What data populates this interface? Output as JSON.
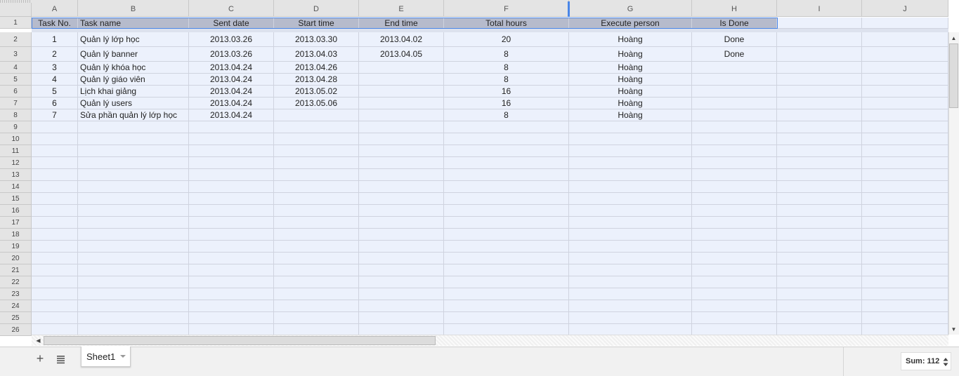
{
  "columns": [
    "A",
    "B",
    "C",
    "D",
    "E",
    "F",
    "G",
    "H",
    "I",
    "J"
  ],
  "header_row": [
    "Task No.",
    "Task name",
    "Sent date",
    "Start time",
    "End time",
    "Total hours",
    "Execute person",
    "Is Done",
    "",
    ""
  ],
  "rows": [
    [
      "1",
      "Quản lý lớp học",
      "2013.03.26",
      "2013.03.30",
      "2013.04.02",
      "20",
      "Hoàng",
      "Done",
      "",
      ""
    ],
    [
      "2",
      "Quản lý banner",
      "2013.03.26",
      "2013.04.03",
      "2013.04.05",
      "8",
      "Hoàng",
      "Done",
      "",
      ""
    ],
    [
      "3",
      "Quản lý khóa học",
      "2013.04.24",
      "2013.04.26",
      "",
      "8",
      "Hoàng",
      "",
      "",
      ""
    ],
    [
      "4",
      "Quản lý giáo viên",
      "2013.04.24",
      "2013.04.28",
      "",
      "8",
      "Hoàng",
      "",
      "",
      ""
    ],
    [
      "5",
      "Lịch khai giảng",
      "2013.04.24",
      "2013.05.02",
      "",
      "16",
      "Hoàng",
      "",
      "",
      ""
    ],
    [
      "6",
      "Quản lý users",
      "2013.04.24",
      "2013.05.06",
      "",
      "16",
      "Hoàng",
      "",
      "",
      ""
    ],
    [
      "7",
      "Sửa phần quản lý lớp học",
      "2013.04.24",
      "",
      "",
      "8",
      "Hoàng",
      "",
      "",
      ""
    ]
  ],
  "row_numbers": [
    "1",
    "2",
    "3",
    "4",
    "5",
    "6",
    "7",
    "8",
    "9",
    "10",
    "11",
    "12",
    "13",
    "14",
    "15",
    "16",
    "17",
    "18",
    "19",
    "20",
    "21",
    "22",
    "23",
    "24",
    "25",
    "26"
  ],
  "sheet_tab": {
    "label": "Sheet1"
  },
  "status": {
    "sum_label": "Sum: 112"
  },
  "icons": {
    "add": "plus-icon",
    "list": "list-icon",
    "tab_menu": "caret-down-icon",
    "sum_menu": "up-down-arrows-icon"
  },
  "colors": {
    "header_fill": "#b6bbcc",
    "cell_fill": "#ecf1fc",
    "selection": "#4a86e8"
  }
}
